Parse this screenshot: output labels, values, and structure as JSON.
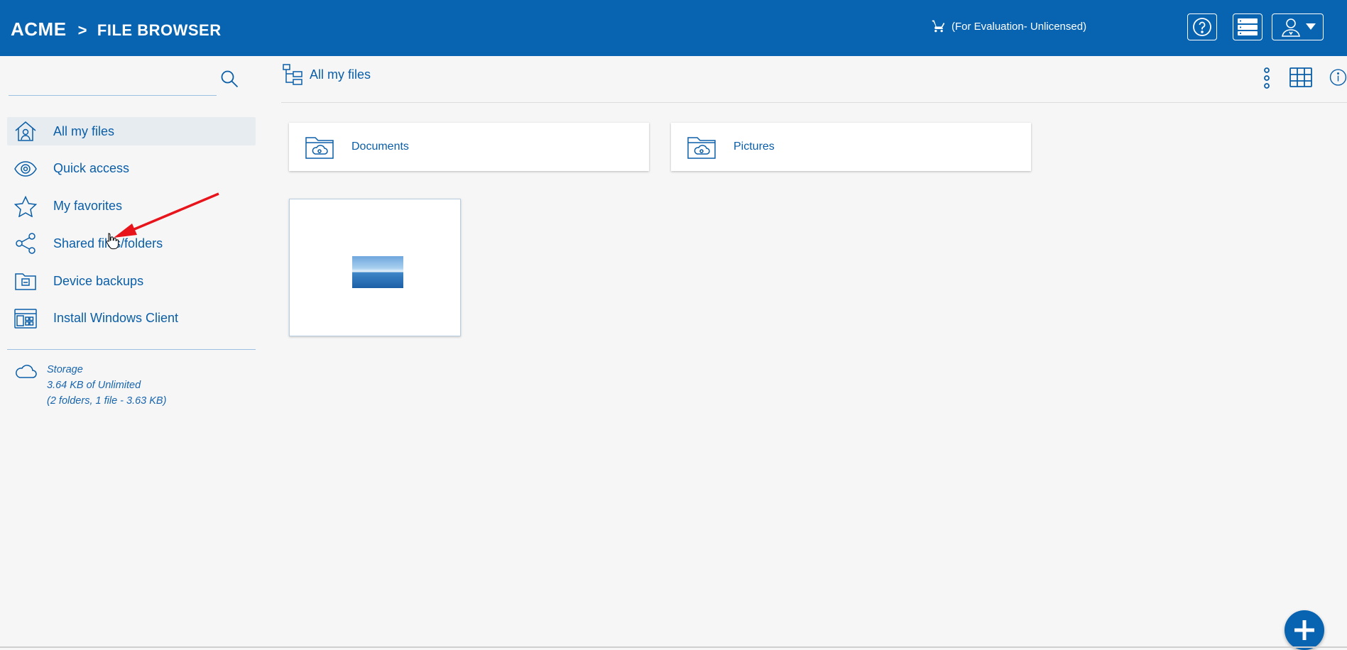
{
  "header": {
    "brand": "ACME",
    "separator": ">",
    "section": "FILE BROWSER",
    "license_text": "(For Evaluation- Unlicensed)",
    "icons": {
      "cart": "cart-icon",
      "help": "help-icon",
      "server": "server-icon",
      "user": "user-icon",
      "dropdown": "caret-down-icon"
    }
  },
  "sidebar": {
    "search": {
      "placeholder": "",
      "value": ""
    },
    "items": [
      {
        "label": "All my files",
        "icon": "home-icon",
        "active": true
      },
      {
        "label": "Quick access",
        "icon": "eye-icon",
        "active": false
      },
      {
        "label": "My favorites",
        "icon": "star-icon",
        "active": false
      },
      {
        "label": "Shared files/folders",
        "icon": "share-icon",
        "active": false
      },
      {
        "label": "Device backups",
        "icon": "backup-folder-icon",
        "active": false
      },
      {
        "label": "Install Windows Client",
        "icon": "windows-client-icon",
        "active": false
      }
    ],
    "storage": {
      "title": "Storage",
      "usage": "3.64 KB of Unlimited",
      "details": "(2 folders, 1 file - 3.63 KB)"
    }
  },
  "main": {
    "breadcrumb": "All my files",
    "folders": [
      {
        "name": "Documents",
        "icon": "cloud-folder-icon"
      },
      {
        "name": "Pictures",
        "icon": "cloud-folder-icon"
      }
    ],
    "files": [
      {
        "name": "",
        "thumbnail": "sea-sky-image"
      }
    ]
  },
  "colors": {
    "header_bg": "#0864b1",
    "accent": "#0a5ea8",
    "page_bg": "#f6f6f6",
    "annotation_arrow": "#e8141b"
  }
}
